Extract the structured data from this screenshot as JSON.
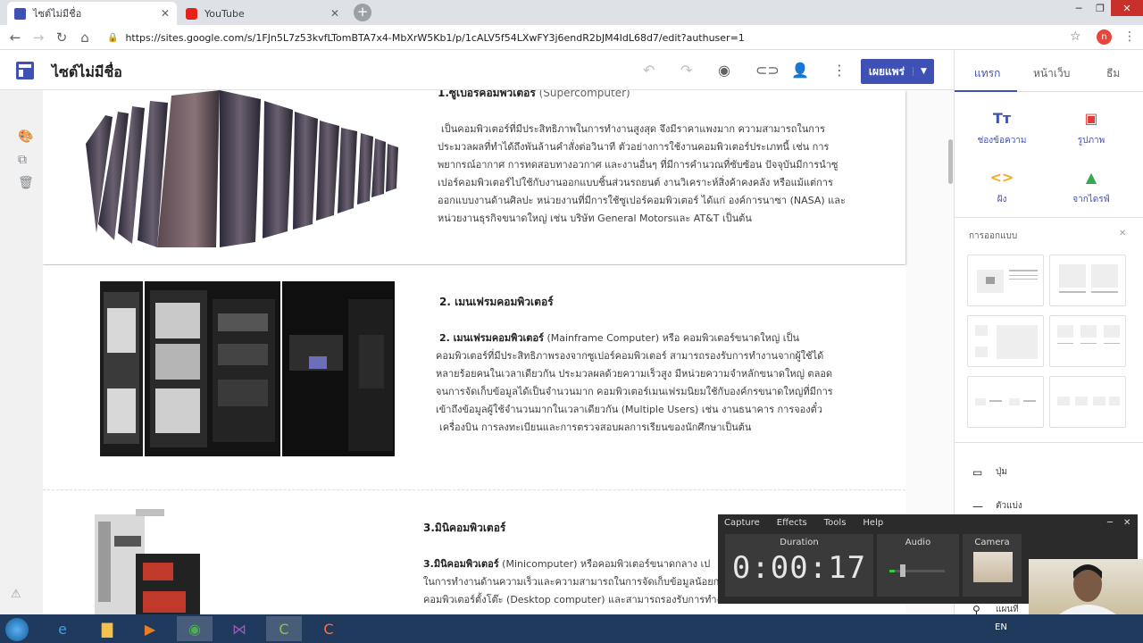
{
  "browser": {
    "tabs": [
      {
        "title": "ไซต์ไม่มีชื่อ"
      },
      {
        "title": "YouTube"
      }
    ],
    "url": "https://sites.google.com/s/1FJn5L7z53kvfLTomBTA7x4-MbXrW5Kb1/p/1cALV5f54LXwFY3j6endR2bJM4IdL68d7/edit?authuser=1",
    "profile_initial": "n"
  },
  "sites": {
    "title": "ไซต์ไม่มีชื่อ",
    "publish_label": "เผยแพร่"
  },
  "content": {
    "s1_heading_bold": "1.ซูเปอร์คอมพิวเตอร์",
    "s1_heading_rest": " (Supercomputer)",
    "s1_lines": [
      "เป็นคอมพิวเตอร์ที่มีประสิทธิภาพในการทำงานสูงสุด จึงมีราคาแพงมาก ความสามารถในการ",
      "ประมวลผลที่ทำได้ถึงพันล้านคำสั่งต่อวินาที ตัวอย่างการใช้งานคอมพิวเตอร์ประเภทนี้ เช่น การ",
      "พยากรณ์อากาศ การทดสอบทางอวกาศ และงานอื่นๆ ที่มีการคำนวณที่ซับซ้อน ปัจจุบันมีการนำซู",
      "เปอร์คอมพิวเตอร์ไปใช้กับงานออกแบบชิ้นส่วนรถยนต์ งานวิเคราะห์สิ่งค้าคงคลัง หรือแม้แต่การ",
      "ออกแบบงานด้านศิลปะ หน่วยงานที่มีการใช้ซูเปอร์คอมพิวเตอร์ ได้แก่ องค์การนาซา (NASA) และ",
      "หน่วยงานธุรกิจขนาดใหญ่ เช่น บริษัท General Motorsและ AT&T เป็นต้น"
    ],
    "s2_heading": "2. เมนเฟรมคอมพิวเตอร์",
    "s2_lead_bold": "2. เมนเฟรมคอมพิวเตอร์",
    "s2_lead_rest": " (Mainframe Computer) หรือ คอมพิวเตอร์ขนาดใหญ่ เป็น",
    "s2_lines": [
      "คอมพิวเตอร์ที่มีประสิทธิภาพรองจากซูเปอร์คอมพิวเตอร์ สามารถรองรับการทำงานจากผู้ใช้ได้",
      "หลายร้อยคนในเวลาเดียวกัน ประมวลผลด้วยความเร็วสูง มีหน่วยความจำหลักขนาดใหญ่ ตลอด",
      "จนการจัดเก็บข้อมูลได้เป็นจำนวนมาก คอมพิวเตอร์เมนเฟรมนิยมใช้กับองค์กรขนาดใหญ่ที่มีการ",
      "เข้าถึงข้อมูลผู้ใช้จำนวนมากในเวลาเดียวกัน (Multiple Users) เช่น งานธนาคาร การจองตั๋ว",
      "เครื่องบิน การลงทะเบียนและการตรวจสอบผลการเรียนของนักศึกษาเป็นต้น"
    ],
    "s3_heading": "3.มินิคอมพิวเตอร์",
    "s3_lead_bold": "3.มินิคอมพิวเตอร์",
    "s3_lead_rest": " (Minicomputer) หรือคอมพิวเตอร์ขนาดกลาง เป",
    "s3_lines": [
      "ในการทำงานด้านความเร็วและความสามารถในการจัดเก็บข้อมูลน้อยก",
      "คอมพิวเตอร์ตั้งโต๊ะ (Desktop computer) และสามารถรองรับการทำงาน"
    ]
  },
  "panel": {
    "tabs": [
      "แทรก",
      "หน้าเว็บ",
      "ธีม"
    ],
    "insert": [
      {
        "label": "ช่องข้อความ",
        "icon": "text-box-icon"
      },
      {
        "label": "รูปภาพ",
        "icon": "image-icon"
      },
      {
        "label": "ฝัง",
        "icon": "embed-icon"
      },
      {
        "label": "จากไดรฟ์",
        "icon": "drive-icon"
      }
    ],
    "design_label": "การออกแบบ",
    "items": [
      {
        "label": "ปุ่ม"
      },
      {
        "label": "ตัวแบ่ง"
      },
      {
        "label": "แผนที่"
      }
    ]
  },
  "capture": {
    "menu": [
      "Capture",
      "Effects",
      "Tools",
      "Help"
    ],
    "duration_label": "Duration",
    "duration": "0:00:17",
    "audio_label": "Audio",
    "camera_label": "Camera"
  },
  "taskbar": {
    "lang": "EN"
  },
  "colors": {
    "accent": "#3f51b5",
    "taskbar": "#1f3a5c",
    "capture_bg": "#2b2b2b"
  }
}
